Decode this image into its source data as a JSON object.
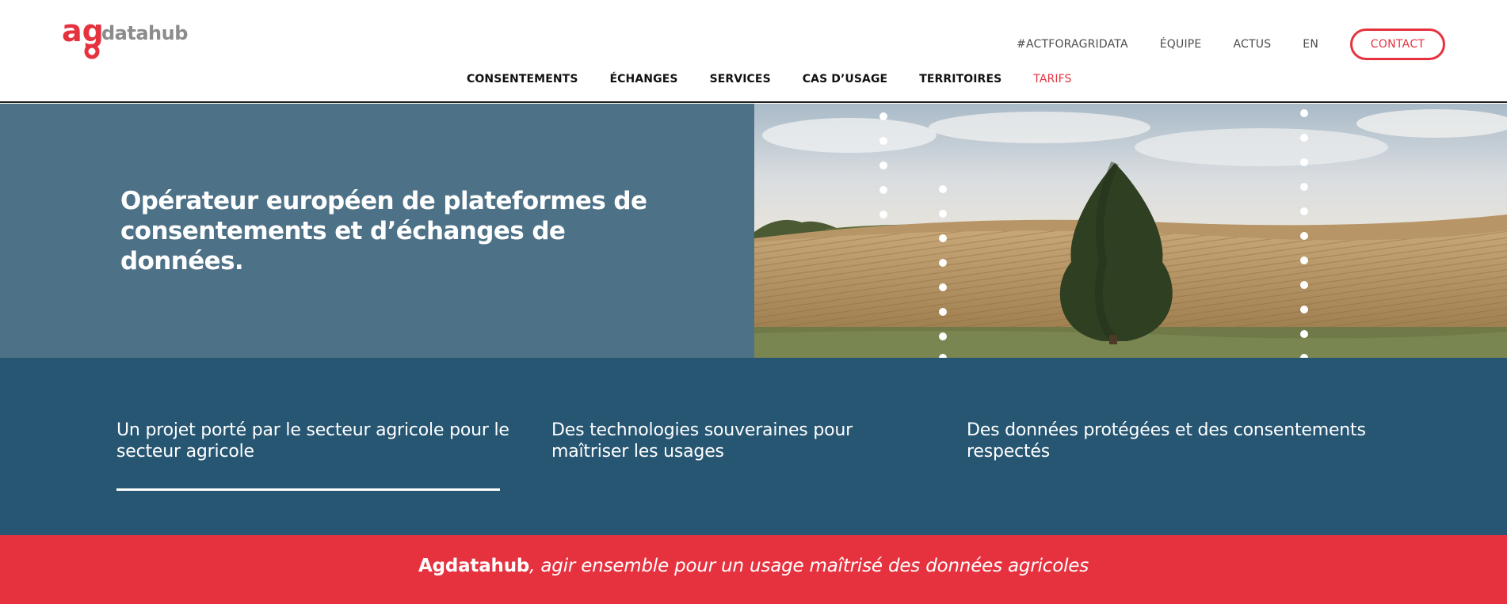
{
  "header": {
    "logo": {
      "mark": "ag",
      "wordmark": "datahub",
      "mark_color": "#e6323f",
      "wordmark_color": "#8c8c8c"
    },
    "utility_nav": [
      {
        "label": "#ACTFORAGRIDATA"
      },
      {
        "label": "ÉQUIPE"
      },
      {
        "label": "ACTUS"
      },
      {
        "label": "EN"
      }
    ],
    "contact_label": "CONTACT",
    "main_nav": [
      {
        "label": "CONSENTEMENTS"
      },
      {
        "label": "ÉCHANGES"
      },
      {
        "label": "SERVICES"
      },
      {
        "label": "CAS D’USAGE"
      },
      {
        "label": "TERRITOIRES"
      },
      {
        "label": "TARIFS",
        "active": true
      }
    ]
  },
  "hero": {
    "title": "Opérateur européen de plateformes de consentements et d’échanges de données.",
    "image": "photo of a lone tree in a harvested wheat field under a cloudy sky, with dotted white vertical lines overlay"
  },
  "features": [
    {
      "text": "Un projet porté par le secteur agricole pour le secteur agricole"
    },
    {
      "text": "Des technologies souveraines pour maîtriser les usages"
    },
    {
      "text": "Des données protégées et des consentements respectés"
    }
  ],
  "banner": {
    "brand": "Agdatahub",
    "tagline": ", agir ensemble pour un usage maîtrisé des données agricoles"
  },
  "colors": {
    "accent": "#e6323f",
    "hero_panel": "#4d7186",
    "features_bg": "#275672"
  }
}
